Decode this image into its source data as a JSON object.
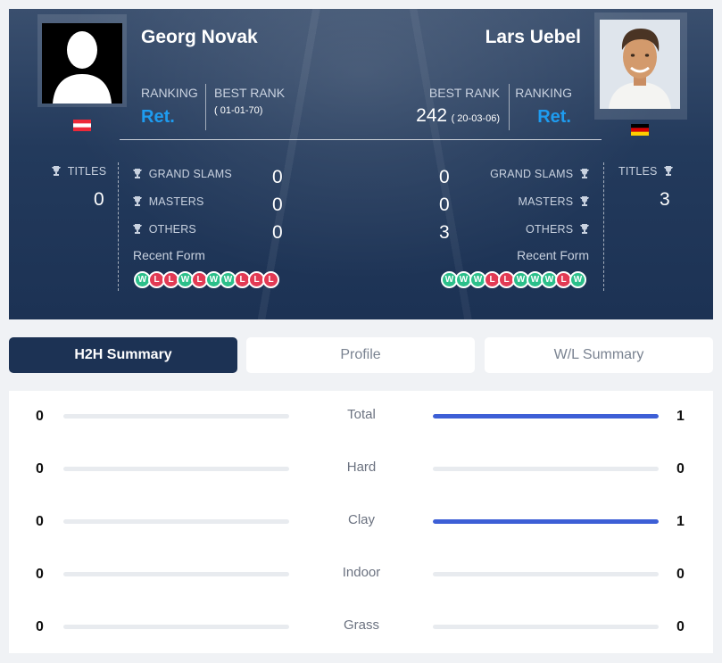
{
  "player1": {
    "name": "Georg Novak",
    "flag": "austria-flag",
    "ranking_label": "RANKING",
    "ranking": "Ret.",
    "best_rank_label": "BEST RANK",
    "best_rank": "",
    "best_rank_date": "( 01-01-70)",
    "titles_label": "TITLES",
    "titles": "0",
    "grand_slams_label": "GRAND SLAMS",
    "grand_slams": "0",
    "masters_label": "MASTERS",
    "masters": "0",
    "others_label": "OTHERS",
    "others": "0",
    "recent_form_label": "Recent Form",
    "recent_form": [
      "W",
      "L",
      "L",
      "W",
      "L",
      "W",
      "W",
      "L",
      "L",
      "L"
    ]
  },
  "player2": {
    "name": "Lars Uebel",
    "flag": "germany-flag",
    "ranking_label": "RANKING",
    "ranking": "Ret.",
    "best_rank_label": "BEST RANK",
    "best_rank": "242",
    "best_rank_date": "( 20-03-06)",
    "titles_label": "TITLES",
    "titles": "3",
    "grand_slams_label": "GRAND SLAMS",
    "grand_slams": "0",
    "masters_label": "MASTERS",
    "masters": "0",
    "others_label": "OTHERS",
    "others": "3",
    "recent_form_label": "Recent Form",
    "recent_form": [
      "W",
      "W",
      "W",
      "L",
      "L",
      "W",
      "W",
      "W",
      "L",
      "W"
    ]
  },
  "tabs": [
    "H2H Summary",
    "Profile",
    "W/L Summary"
  ],
  "active_tab": 0,
  "h2h": [
    {
      "label": "Total",
      "left": "0",
      "right": "1",
      "left_frac": 0,
      "right_frac": 1
    },
    {
      "label": "Hard",
      "left": "0",
      "right": "0",
      "left_frac": 0,
      "right_frac": 0
    },
    {
      "label": "Clay",
      "left": "0",
      "right": "1",
      "left_frac": 0,
      "right_frac": 1
    },
    {
      "label": "Indoor",
      "left": "0",
      "right": "0",
      "left_frac": 0,
      "right_frac": 0
    },
    {
      "label": "Grass",
      "left": "0",
      "right": "0",
      "left_frac": 0,
      "right_frac": 0
    }
  ],
  "colors": {
    "accent": "#1e9cf0",
    "bar": "#3d5fd6",
    "win": "#2bbf8a",
    "loss": "#e23a54",
    "header": "#1c3254"
  }
}
